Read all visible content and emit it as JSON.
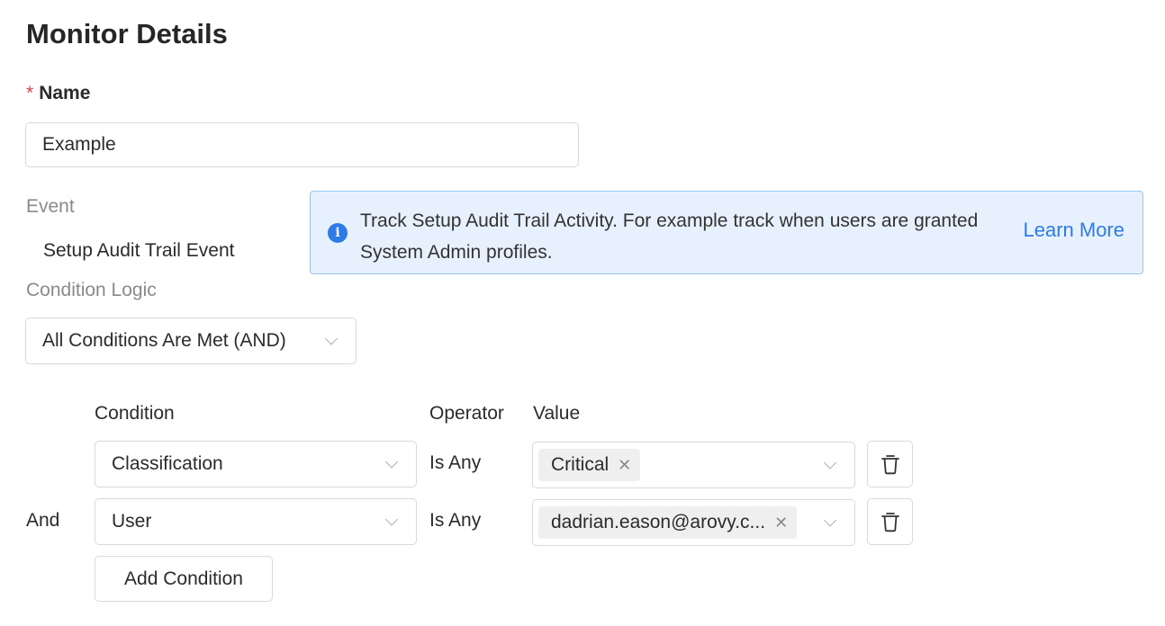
{
  "page": {
    "title": "Monitor Details"
  },
  "name_field": {
    "required_marker": "*",
    "label": "Name",
    "value": "Example"
  },
  "event": {
    "label": "Event",
    "value": "Setup Audit Trail Event"
  },
  "info_banner": {
    "icon": "info-icon",
    "text": "Track Setup Audit Trail Activity. For example track when users are granted System Admin profiles.",
    "link_label": "Learn More",
    "accent_color": "#2f7be6",
    "background_color": "#e6f1fd"
  },
  "condition_logic": {
    "label": "Condition Logic",
    "selected": "All Conditions Are Met (AND)"
  },
  "conditions_table": {
    "headers": {
      "condition": "Condition",
      "operator": "Operator",
      "value": "Value"
    },
    "rows": [
      {
        "connector": "",
        "condition": "Classification",
        "operator": "Is Any",
        "value_tag": "Critical"
      },
      {
        "connector": "And",
        "condition": "User",
        "operator": "Is Any",
        "value_tag": "dadrian.eason@arovy.c..."
      }
    ],
    "add_button_label": "Add Condition"
  }
}
